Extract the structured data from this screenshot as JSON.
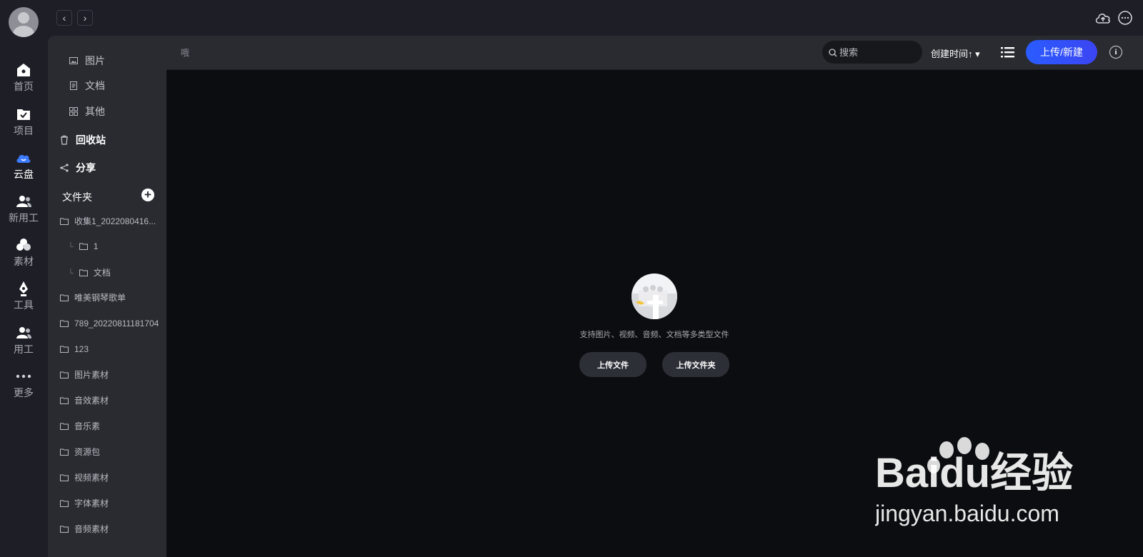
{
  "nav": {
    "back_glyph": "‹",
    "forward_glyph": "›"
  },
  "rail": {
    "items": [
      {
        "label": "首页",
        "icon": "home-icon"
      },
      {
        "label": "项目",
        "icon": "project-folder-icon"
      },
      {
        "label": "云盘",
        "icon": "cloud-icon",
        "active": true
      },
      {
        "label": "新用工",
        "icon": "users-icon"
      },
      {
        "label": "素材",
        "icon": "material-icon"
      },
      {
        "label": "工具",
        "icon": "pen-tool-icon"
      },
      {
        "label": "用工",
        "icon": "users-icon"
      },
      {
        "label": "更多",
        "icon": "more-dots-icon"
      }
    ]
  },
  "side": {
    "categories": [
      {
        "label": "图片",
        "icon": "image-icon"
      },
      {
        "label": "文档",
        "icon": "document-icon"
      },
      {
        "label": "其他",
        "icon": "grid-icon"
      }
    ],
    "recycle_label": "回收站",
    "share_label": "分享",
    "folders_title": "文件夹",
    "add_folder_glyph": "+",
    "folders": [
      {
        "name": "收集1_2022080416...",
        "child": false
      },
      {
        "name": "1",
        "child": true
      },
      {
        "name": "文档",
        "child": true
      },
      {
        "name": "唯美钢琴歌单",
        "child": false
      },
      {
        "name": "789_20220811181704",
        "child": false
      },
      {
        "name": "123",
        "child": false
      },
      {
        "name": "图片素材",
        "child": false
      },
      {
        "name": "音效素材",
        "child": false
      },
      {
        "name": "音乐素",
        "child": false
      },
      {
        "name": "资源包",
        "child": false
      },
      {
        "name": "视频素材",
        "child": false
      },
      {
        "name": "字体素材",
        "child": false
      },
      {
        "name": "音频素材",
        "child": false
      }
    ]
  },
  "toolbar": {
    "breadcrumb": "哦",
    "search_placeholder": "搜索",
    "sort_label": "创建时间↑ ▾",
    "upload_new_label": "上传/新建",
    "info_glyph": "i"
  },
  "empty": {
    "text": "支持图片、视频、音频、文档等多类型文件",
    "upload_file_label": "上传文件",
    "upload_folder_label": "上传文件夹"
  },
  "watermark": {
    "brand": "Baidu经验",
    "url": "jingyan.baidu.com"
  },
  "colors": {
    "accent": "#2a5cff",
    "rail_bg": "#1e1f26",
    "panel_bg": "#2a2b31",
    "main_bg": "#0c0d10"
  }
}
